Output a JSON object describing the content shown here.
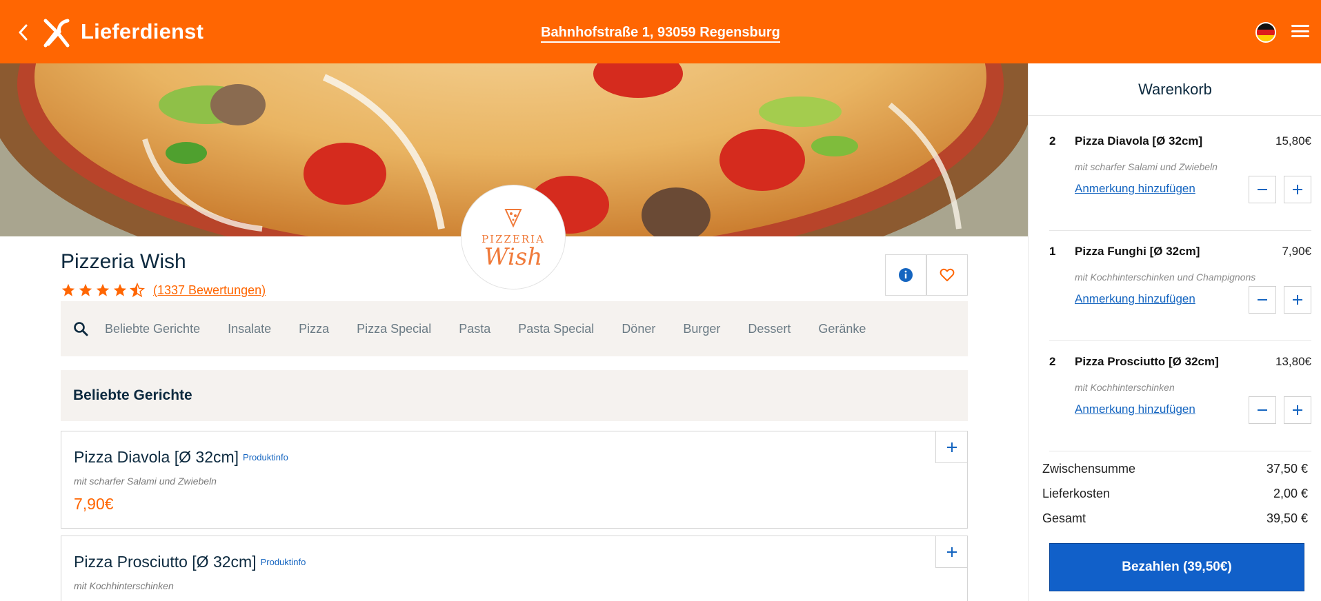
{
  "header": {
    "brand": "Lieferdienst",
    "address": "Bahnhofstraße 1, 93059 Regensburg",
    "back_icon": "chevron-left-icon",
    "logo_icon": "cutlery-icon",
    "language_icon": "german-flag-icon",
    "menu_icon": "hamburger-menu-icon"
  },
  "restaurant": {
    "name": "Pizzeria Wish",
    "logo_line1": "PIZZERIA",
    "logo_line2": "Wish",
    "rating": 4.5,
    "rating_max": 5,
    "reviews": "(1337 Bewertungen)"
  },
  "categories": [
    "Beliebte Gerichte",
    "Insalate",
    "Pizza",
    "Pizza Special",
    "Pasta",
    "Pasta Special",
    "Döner",
    "Burger",
    "Dessert",
    "Geränke"
  ],
  "section_title": "Beliebte Gerichte",
  "products": [
    {
      "name": "Pizza Diavola [Ø 32cm]",
      "info": "Produktinfo",
      "desc": "mit scharfer Salami und Zwiebeln",
      "price": "7,90€"
    },
    {
      "name": "Pizza Prosciutto [Ø 32cm]",
      "info": "Produktinfo",
      "desc": "mit Kochhinterschinken",
      "price": ""
    }
  ],
  "cart": {
    "title": "Warenkorb",
    "items": [
      {
        "qty": "2",
        "name": "Pizza Diavola [Ø 32cm]",
        "price": "15,80€",
        "desc": "mit scharfer Salami und Zwiebeln",
        "note": "Anmerkung hinzufügen"
      },
      {
        "qty": "1",
        "name": "Pizza Funghi [Ø 32cm]",
        "price": "7,90€",
        "desc": "mit Kochhinterschinken und Champignons",
        "note": "Anmerkung hinzufügen"
      },
      {
        "qty": "2",
        "name": "Pizza Prosciutto [Ø 32cm]",
        "price": "13,80€",
        "desc": "mit Kochhinterschinken",
        "note": "Anmerkung hinzufügen"
      }
    ],
    "subtotal_label": "Zwischensumme",
    "subtotal": "37,50 €",
    "delivery_label": "Lieferkosten",
    "delivery": "2,00 €",
    "total_label": "Gesamt",
    "total": "39,50 €",
    "pay_label": "Bezahlen (39,50€)"
  },
  "colors": {
    "brand_orange": "#ff6602",
    "pay_blue": "#1160c9",
    "link_blue": "#1565c0"
  }
}
